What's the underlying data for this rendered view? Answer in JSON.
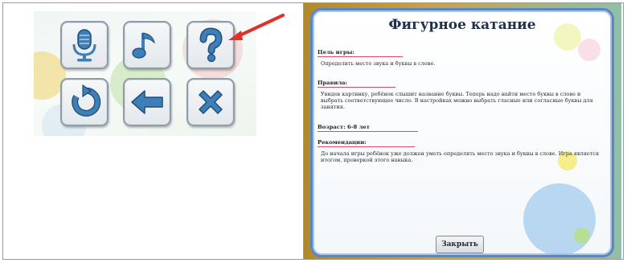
{
  "game_menu": {
    "buttons": [
      {
        "icon": "microphone-icon",
        "color": "#3d7fb6"
      },
      {
        "icon": "music-note-icon",
        "color": "#3d7fb6"
      },
      {
        "icon": "question-mark-icon",
        "color": "#3d7fb6"
      },
      {
        "icon": "replay-icon",
        "color": "#3d7fb6"
      },
      {
        "icon": "arrow-left-icon",
        "color": "#3d7fb6"
      },
      {
        "icon": "close-x-icon",
        "color": "#3d7fb6"
      }
    ],
    "pointer_color": "#e0322a"
  },
  "help_dialog": {
    "title": "Фигурное катание",
    "sections": [
      {
        "heading": "Цель игры:",
        "body": "Определить место звука и буквы в слове."
      },
      {
        "heading": "Правила:",
        "body": "Увидев картинку, ребёнок слышит название буквы. Теперь надо найти место буквы в слове и выбрать соответствующее число. В настройках можно выбрать гласные или согласные буквы для занятия."
      },
      {
        "heading": "Возраст: 6-8 лет",
        "body": ""
      },
      {
        "heading": "Рекомендации:",
        "body": "До начала игры ребёнок уже должен уметь определять место звука и буквы в слове. Игра является итогом, проверкой этого навыка."
      }
    ],
    "close_label": "Закрыть",
    "accent_color": "#5b86c5"
  }
}
